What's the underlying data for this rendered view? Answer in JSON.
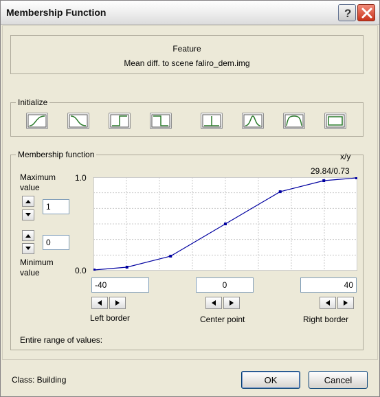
{
  "window": {
    "title": "Membership Function"
  },
  "feature": {
    "heading": "Feature",
    "name": "Mean diff. to scene faliro_dem.img"
  },
  "initialize": {
    "label": "Initialize",
    "buttons": [
      "larger-icon",
      "smaller-icon",
      "larger-boolean-icon",
      "smaller-boolean-icon",
      "singleton-icon",
      "approximate-gaussian-icon",
      "approximate-range-icon",
      "full-range-icon"
    ]
  },
  "membership": {
    "label": "Membership function",
    "xy_label": "x/y",
    "readout": "29.84/0.73",
    "max_label_1": "Maximum",
    "max_label_2": "value",
    "max_value": "1",
    "min_value": "0",
    "min_label_1": "Minimum",
    "min_label_2": "value",
    "y_top_tick": "1.0",
    "y_bottom_tick": "0.0",
    "left_border_value": "-40",
    "center_point_value": "0",
    "right_border_value": "40",
    "left_border_label": "Left border",
    "center_point_label": "Center point",
    "right_border_label": "Right border",
    "entire_range_label": "Entire range of values:"
  },
  "chart_data": {
    "type": "line",
    "x": [
      -40,
      -30,
      -16.7,
      0,
      16.7,
      30,
      40
    ],
    "y": [
      0.0,
      0.03,
      0.15,
      0.5,
      0.85,
      0.97,
      1.0
    ],
    "xlim": [
      -40,
      40
    ],
    "ylim": [
      0,
      1
    ],
    "grid": true
  },
  "footer": {
    "class_label": "Class: Building",
    "ok_label": "OK",
    "cancel_label": "Cancel"
  },
  "colors": {
    "curve": "#0000a0",
    "grid": "#c8c8c8"
  }
}
